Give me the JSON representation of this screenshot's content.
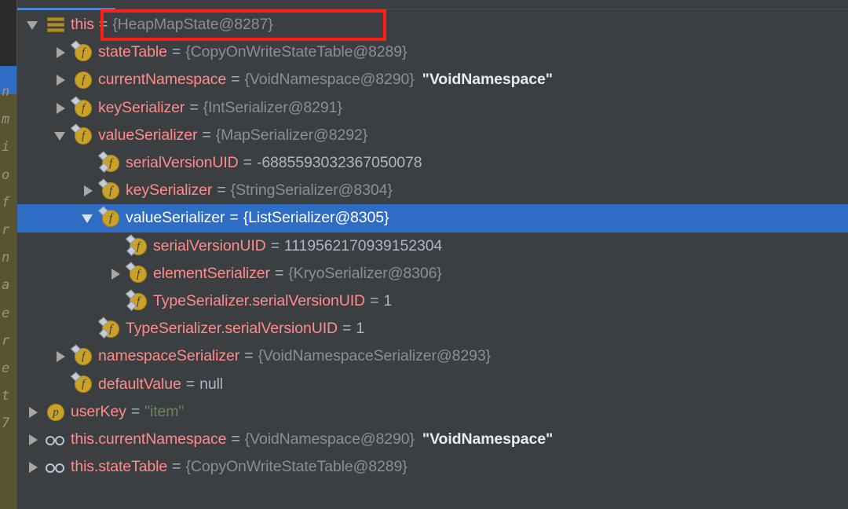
{
  "panel": {
    "name": "debugger-variables-tree",
    "background_color": "#3c3f41",
    "selection_color": "#2f6dc4",
    "accent_tab_color": "#4a88c7",
    "annotation_color": "#ff2015"
  },
  "editor_sliver": {
    "visible_chars": [
      "n",
      "m",
      "i",
      "o",
      "f",
      "r",
      "n",
      "a",
      "e",
      "r",
      "e",
      "t",
      "7"
    ]
  },
  "tokens": {
    "equals": "=",
    "quote": "\""
  },
  "rows": [
    {
      "indent": 0,
      "toggle": "expanded",
      "icon": "this-icon",
      "name": "this",
      "value_ref": "{HeapMapState@8287}",
      "value_str": "",
      "selected": false
    },
    {
      "indent": 1,
      "toggle": "collapsed",
      "icon": "field-final-icon",
      "name": "stateTable",
      "value_ref": "{CopyOnWriteStateTable@8289}",
      "value_str": "",
      "selected": false
    },
    {
      "indent": 1,
      "toggle": "collapsed",
      "icon": "field-icon",
      "name": "currentNamespace",
      "value_ref": "{VoidNamespace@8290}",
      "value_str": "\"VoidNamespace\"",
      "selected": false
    },
    {
      "indent": 1,
      "toggle": "collapsed",
      "icon": "field-final-icon",
      "name": "keySerializer",
      "value_ref": "{IntSerializer@8291}",
      "value_str": "",
      "selected": false
    },
    {
      "indent": 1,
      "toggle": "expanded",
      "icon": "field-final-icon",
      "name": "valueSerializer",
      "value_ref": "{MapSerializer@8292}",
      "value_str": "",
      "selected": false
    },
    {
      "indent": 2,
      "toggle": "none",
      "icon": "field-static-final-icon",
      "name": "serialVersionUID",
      "value_num": "-6885593032367050078",
      "selected": false
    },
    {
      "indent": 2,
      "toggle": "collapsed",
      "icon": "field-final-icon",
      "name": "keySerializer",
      "value_ref": "{StringSerializer@8304}",
      "value_str": "",
      "selected": false
    },
    {
      "indent": 2,
      "toggle": "expanded",
      "icon": "field-final-icon",
      "name": "valueSerializer",
      "value_ref": "{ListSerializer@8305}",
      "value_str": "",
      "selected": true
    },
    {
      "indent": 3,
      "toggle": "none",
      "icon": "field-static-final-icon",
      "name": "serialVersionUID",
      "value_num": "1119562170939152304",
      "selected": false
    },
    {
      "indent": 3,
      "toggle": "collapsed",
      "icon": "field-final-icon",
      "name": "elementSerializer",
      "value_ref": "{KryoSerializer@8306}",
      "value_str": "",
      "selected": false
    },
    {
      "indent": 3,
      "toggle": "none",
      "icon": "field-static-final-icon",
      "name": "TypeSerializer.serialVersionUID",
      "value_num": "1",
      "selected": false
    },
    {
      "indent": 2,
      "toggle": "none",
      "icon": "field-static-final-icon",
      "name": "TypeSerializer.serialVersionUID",
      "value_num": "1",
      "selected": false
    },
    {
      "indent": 1,
      "toggle": "collapsed",
      "icon": "field-final-icon",
      "name": "namespaceSerializer",
      "value_ref": "{VoidNamespaceSerializer@8293}",
      "value_str": "",
      "selected": false
    },
    {
      "indent": 1,
      "toggle": "none",
      "icon": "field-final-icon",
      "name": "defaultValue",
      "value_null": "null",
      "selected": false
    },
    {
      "indent": 0,
      "toggle": "collapsed",
      "icon": "parameter-icon",
      "name": "userKey",
      "value_strlit": "\"item\"",
      "selected": false
    },
    {
      "indent": 0,
      "toggle": "collapsed",
      "icon": "watch-icon",
      "name": "this.currentNamespace",
      "value_ref": "{VoidNamespace@8290}",
      "value_str": "\"VoidNamespace\"",
      "selected": false
    },
    {
      "indent": 0,
      "toggle": "collapsed",
      "icon": "watch-icon",
      "name": "this.stateTable",
      "value_ref": "{CopyOnWriteStateTable@8289}",
      "value_str": "",
      "selected": false
    }
  ]
}
